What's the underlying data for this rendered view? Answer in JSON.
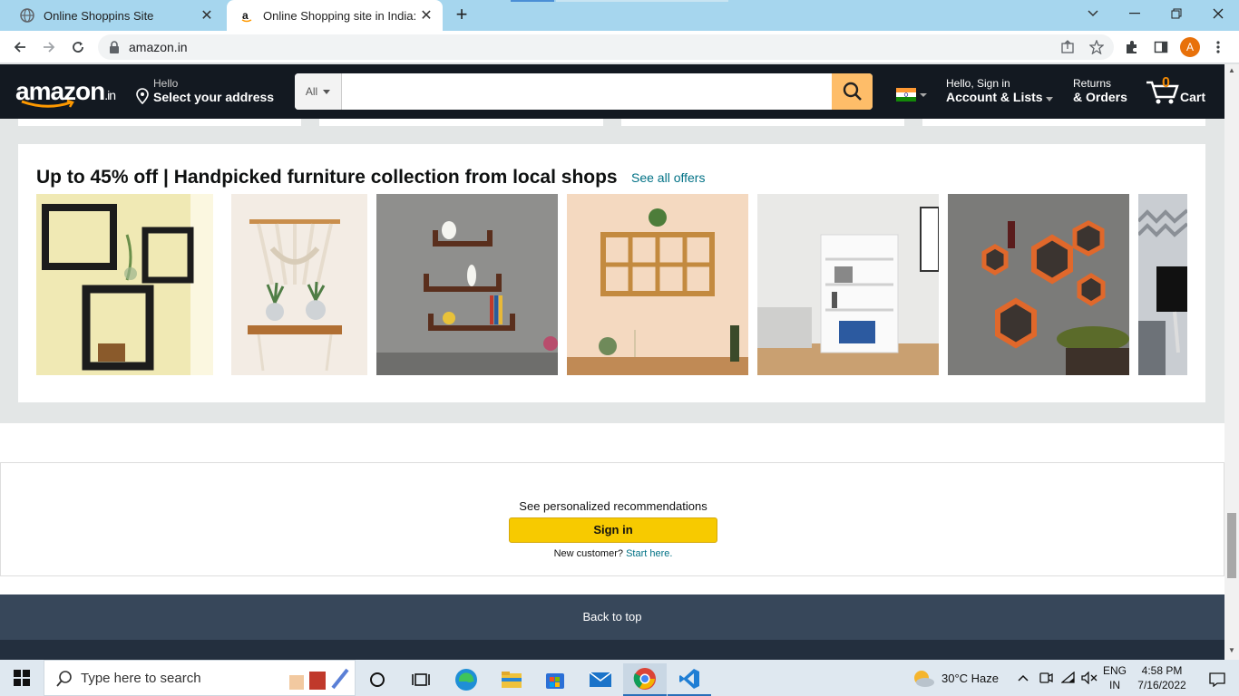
{
  "browser": {
    "tabs": [
      {
        "title": "Online Shoppins Site",
        "active": false
      },
      {
        "title": "Online Shopping site in India: Sh",
        "active": true
      }
    ],
    "url": "amazon.in",
    "profile_initial": "A"
  },
  "nav": {
    "logo_text": "amazon",
    "logo_suffix": ".in",
    "address_hello": "Hello",
    "address_select": "Select your address",
    "search_category": "All",
    "search_placeholder": "",
    "account_line1": "Hello, Sign in",
    "account_line2": "Account & Lists",
    "returns_line1": "Returns",
    "returns_line2": "& Orders",
    "cart_count": "0",
    "cart_label": "Cart"
  },
  "furniture_card": {
    "title": "Up to 45% off | Handpicked furniture collection from local shops",
    "see_all": "See all offers",
    "items": [
      "wall-shelf-black-cubes",
      "macrame-hanging-shelf",
      "floating-u-shelves",
      "wooden-wine-rack-shelf",
      "white-bookshelf",
      "hexagon-orange-shelves",
      "chevron-pillow-partial"
    ]
  },
  "signin_box": {
    "recommendations": "See personalized recommendations",
    "button": "Sign in",
    "new_customer": "New customer?",
    "start_here": "Start here."
  },
  "footer": {
    "back_to_top": "Back to top"
  },
  "taskbar": {
    "search_placeholder": "Type here to search",
    "weather": "30°C  Haze",
    "lang_line1": "ENG",
    "lang_line2": "IN",
    "time": "4:58 PM",
    "date": "7/16/2022"
  },
  "colors": {
    "nav_bg": "#131921",
    "search_button": "#febd69",
    "link": "#007185",
    "signin_button": "#f7ca00",
    "backtop_bg": "#37475a",
    "tab_strip": "#a6d6ee"
  }
}
